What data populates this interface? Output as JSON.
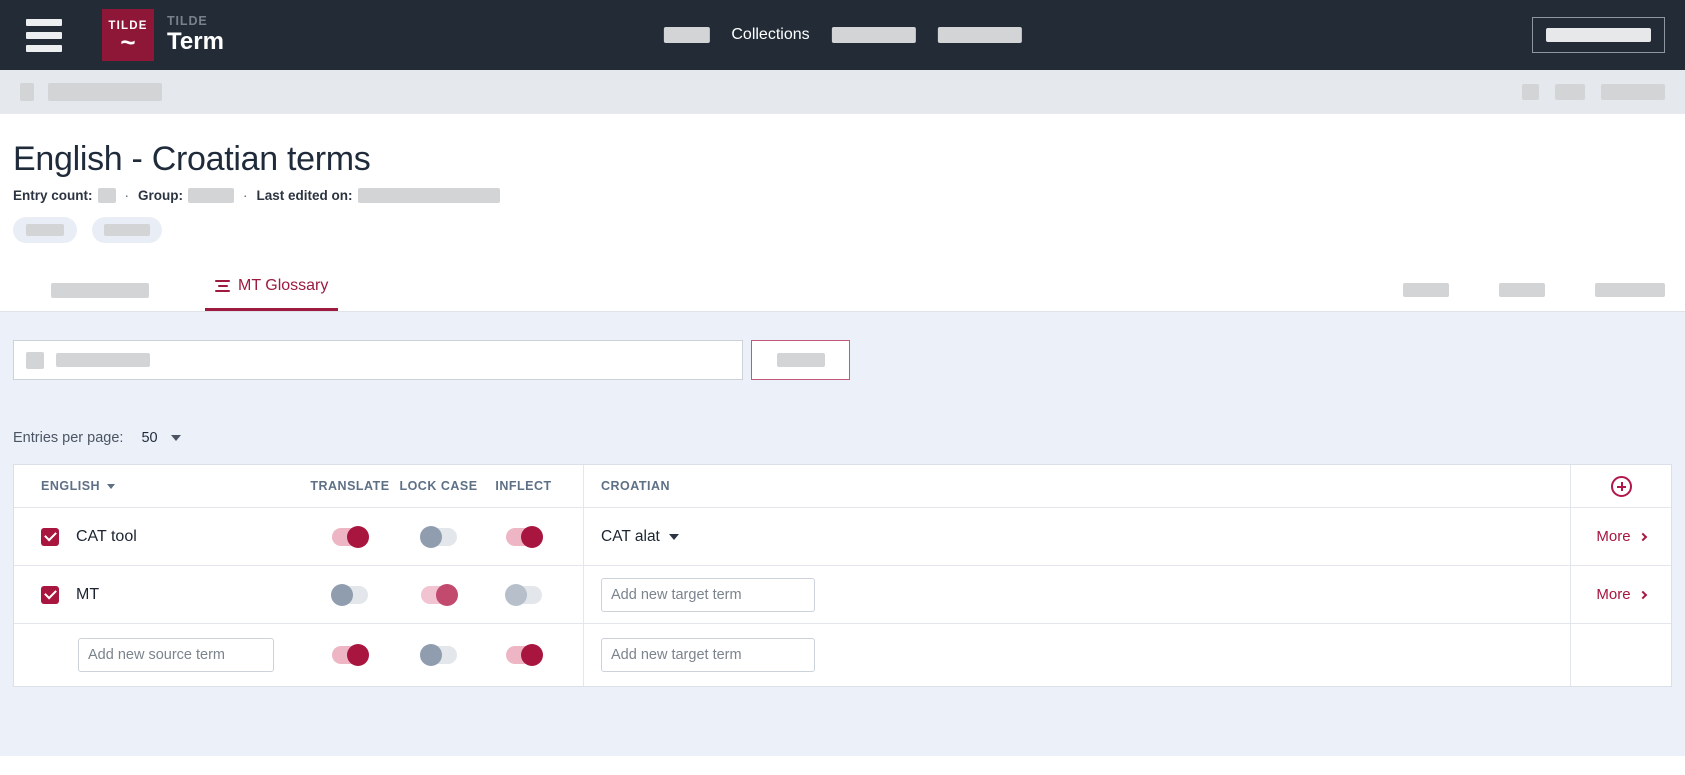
{
  "topnav": {
    "menu_icon": "hamburger-icon",
    "logo": {
      "mark_text": "TILDE",
      "wave": "~"
    },
    "brand_sub": "TILDE",
    "brand_main": "Term",
    "nav_visible_item": "Collections"
  },
  "page": {
    "title": "English - Croatian terms",
    "meta": {
      "entry_count_label": "Entry count:",
      "group_label": "Group:",
      "last_edited_label": "Last edited on:",
      "separator": "·"
    }
  },
  "tabs": {
    "active_tab": "MT Glossary",
    "active_tab_icon": "glossary-list-icon",
    "accent_color": "#9c1b3f"
  },
  "toolbar": {
    "search_icon": "search-icon"
  },
  "pagination": {
    "per_page_label": "Entries per page:",
    "per_page_value": "50",
    "chevron_icon": "chevron-down-icon"
  },
  "table": {
    "headers": {
      "source": "ENGLISH",
      "translate": "TRANSLATE",
      "lock_case": "LOCK CASE",
      "inflect": "INFLECT",
      "target": "CROATIAN"
    },
    "add_icon": "circle-plus-icon",
    "sort_icon": "sort-caret-icon",
    "rows": [
      {
        "checked": true,
        "source": "CAT tool",
        "translate": "on",
        "lock_case": "off",
        "inflect": "on",
        "target": "CAT alat",
        "target_is_input": false,
        "more_label": "More"
      },
      {
        "checked": true,
        "source": "MT",
        "translate": "off",
        "lock_case": "on",
        "inflect": "off",
        "target_placeholder": "Add new target term",
        "target_is_input": true,
        "more_label": "More"
      }
    ],
    "new_row": {
      "source_placeholder": "Add new source term",
      "target_placeholder": "Add new target term",
      "translate": "on",
      "lock_case": "off",
      "inflect": "on"
    }
  },
  "colors": {
    "brand_crimson": "#8e1738",
    "accent": "#a8163f",
    "topbar_bg": "#222b36",
    "panel_bg": "#ecf0f9",
    "title_text": "#1f2b3a"
  }
}
